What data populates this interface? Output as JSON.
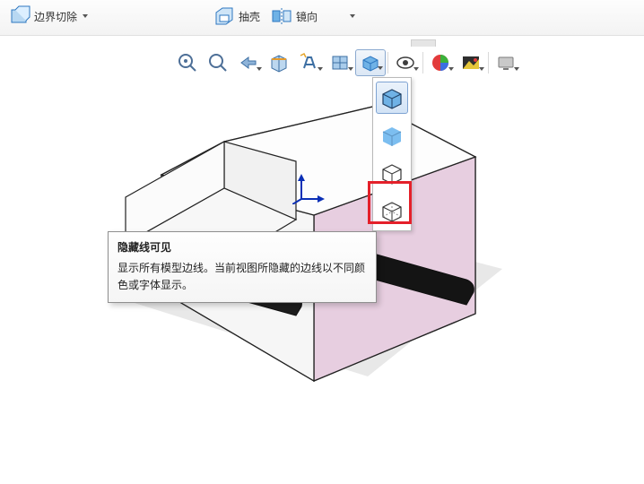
{
  "ribbon": {
    "boundary_cut_label": "边界切除",
    "shell_label": "抽壳",
    "mirror_label": "镜向"
  },
  "hud": {
    "icons": {
      "zoom_to_fit": "zoom-to-fit",
      "zoom_area": "zoom-area",
      "previous_view": "previous-view",
      "section_view": "section-view",
      "dynamic_annotation": "dynamic-annotation",
      "view_orientation": "view-orientation",
      "display_style": "display-style",
      "hide_show": "hide-show",
      "edit_appearance": "edit-appearance",
      "apply_scene": "apply-scene",
      "view_settings": "view-settings"
    }
  },
  "display_style_menu": {
    "options": [
      {
        "id": "shaded-with-edges",
        "label_cn": "带边线上色"
      },
      {
        "id": "shaded",
        "label_cn": "上色"
      },
      {
        "id": "hidden-lines-removed",
        "label_cn": "消除隐藏线"
      },
      {
        "id": "hidden-lines-visible",
        "label_cn": "隐藏线可见"
      }
    ],
    "selected_index": 0,
    "highlighted_index": 3
  },
  "tooltip": {
    "title": "隐藏线可见",
    "body": "显示所有模型边线。当前视图所隐藏的边线以不同颜色或字体显示。"
  },
  "triad_arrows": "↑ ↳",
  "colors": {
    "highlight_red": "#e4202a",
    "selection_blue": "#7ea3d2",
    "model_face_pink": "#e7cee0",
    "model_face_white": "#fdfdfd",
    "model_shadow": "#cfcfcf"
  }
}
